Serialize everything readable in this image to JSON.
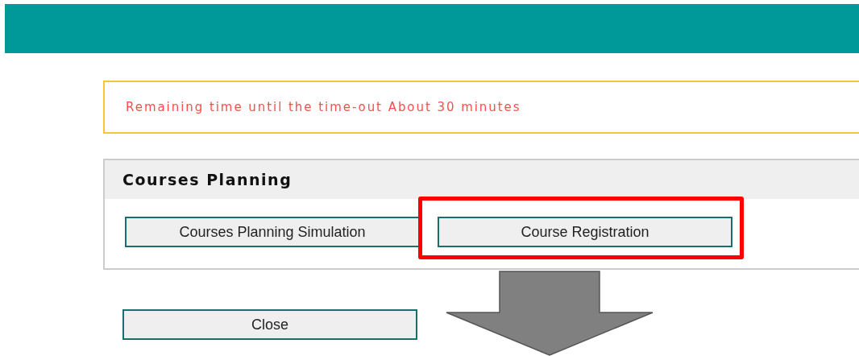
{
  "alert": {
    "text": "Remaining time until the time-out About 30 minutes"
  },
  "panel": {
    "title": "Courses Planning",
    "buttons": [
      {
        "label": "Courses Planning Simulation",
        "highlighted": false
      },
      {
        "label": "Course Registration",
        "highlighted": true
      }
    ]
  },
  "close_button": {
    "label": "Close"
  }
}
